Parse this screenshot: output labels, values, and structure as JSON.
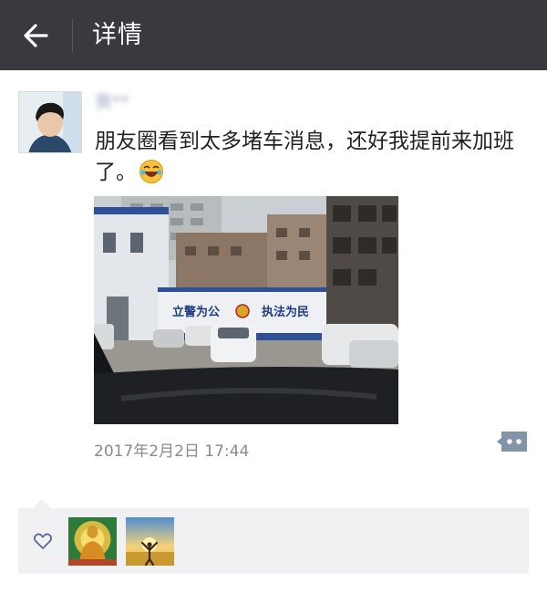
{
  "header": {
    "title": "详情",
    "back_icon": "arrow-left-icon"
  },
  "post": {
    "author_name": "黄**",
    "text": "朋友圈看到太多堵车消息，还好我提前来加班了。",
    "emoji": "laughing-face-emoji",
    "photo": {
      "wall_slogan_left": "立警为公",
      "wall_slogan_right": "执法为民"
    },
    "timestamp": "2017年2月2日 17:44",
    "more_icon": "comment-more-icon"
  },
  "likes": {
    "heart_icon": "heart-outline-icon",
    "likers": [
      "buddha-avatar",
      "sunrise-avatar"
    ]
  },
  "colors": {
    "topbar": "#393a3f",
    "link": "#576b95",
    "likes_bg": "#f1f1f3"
  }
}
